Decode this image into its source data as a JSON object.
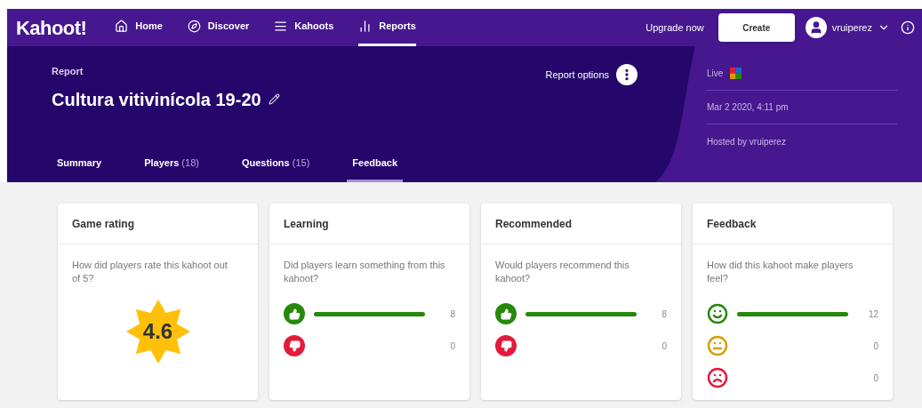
{
  "nav": {
    "logo": "Kahoot!",
    "items": [
      {
        "kind": "home",
        "label": "Home",
        "selected": false
      },
      {
        "kind": "discover",
        "label": "Discover",
        "selected": false
      },
      {
        "kind": "kahoots",
        "label": "Kahoots",
        "selected": false
      },
      {
        "kind": "reports",
        "label": "Reports",
        "selected": true
      }
    ],
    "upgrade": "Upgrade now",
    "create": "Create",
    "user": "vruiperez"
  },
  "header": {
    "eyebrow": "Report",
    "title": "Cultura vitivinícola 19-20",
    "options": "Report options",
    "tabs": [
      {
        "label": "Summary",
        "selected": false
      },
      {
        "label": "Players",
        "count": "(18)",
        "selected": false
      },
      {
        "label": "Questions",
        "count": "(15)",
        "selected": false
      },
      {
        "label": "Feedback",
        "selected": true
      }
    ],
    "meta": [
      {
        "kind": "mode",
        "text": "Live"
      },
      {
        "kind": "date",
        "text": "Mar 2 2020, 4:11 pm"
      },
      {
        "kind": "host",
        "text": "Hosted by vruiperez"
      }
    ]
  },
  "cards": [
    {
      "kind": "rating",
      "title": "Game rating",
      "question": "How did players rate this kahoot out of 5?",
      "score": "4.6"
    },
    {
      "kind": "bars",
      "title": "Learning",
      "question": "Did players learn something from this kahoot?",
      "rows": [
        {
          "kind": "up",
          "count": "8"
        },
        {
          "kind": "down",
          "count": "0"
        }
      ]
    },
    {
      "kind": "bars",
      "title": "Recommended",
      "question": "Would players recommend this kahoot?",
      "rows": [
        {
          "kind": "up",
          "count": "8"
        },
        {
          "kind": "down",
          "count": "0"
        }
      ]
    },
    {
      "kind": "bars",
      "title": "Feedback",
      "question": "How did this kahoot make players feel?",
      "rows": [
        {
          "kind": "happy",
          "count": "12"
        },
        {
          "kind": "neutral",
          "count": "0"
        },
        {
          "kind": "sad",
          "count": "0"
        }
      ]
    }
  ]
}
